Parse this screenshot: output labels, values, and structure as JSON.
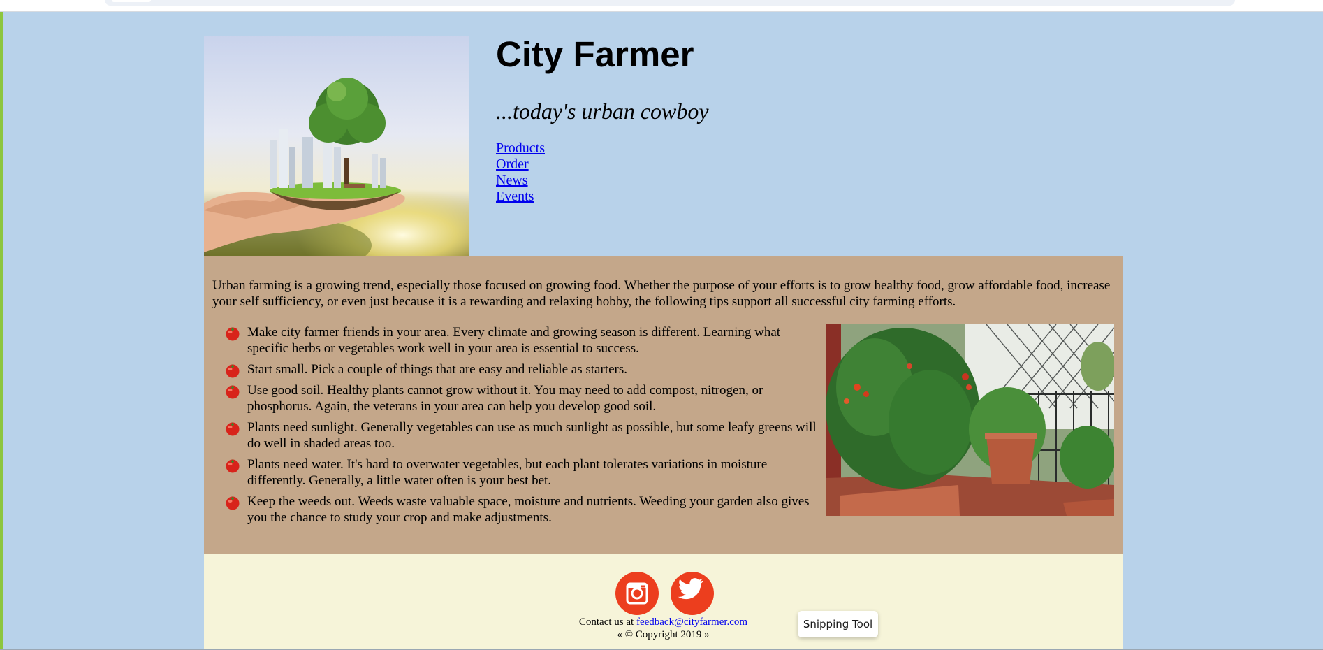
{
  "site": {
    "title": "City Farmer",
    "tagline": "...today's urban cowboy"
  },
  "nav": [
    {
      "label": "Products"
    },
    {
      "label": "Order"
    },
    {
      "label": "News"
    },
    {
      "label": "Events"
    }
  ],
  "intro": "Urban farming is a growing trend, especially those focused on growing food. Whether the purpose of your efforts is to grow healthy food, grow affordable food, increase your self sufficiency, or even just because it is a rewarding and relaxing hobby, the following tips support all successful city farming efforts.",
  "tips": [
    "Make city farmer friends in your area. Every climate and growing season is different. Learning what specific herbs or vegetables work well in your area is essential to success.",
    "Start small. Pick a couple of things that are easy and reliable as starters.",
    "Use good soil. Healthy plants cannot grow without it. You may need to add compost, nitrogen, or phosphorus. Again, the veterans in your area can help you develop good soil.",
    "Plants need sunlight. Generally vegetables can use as much sunlight as possible, but some leafy greens will do well in shaded areas too.",
    "Plants need water. It's hard to overwater vegetables, but each plant tolerates variations in moisture differently. Generally, a little water often is your best bet.",
    "Keep the weeds out. Weeds waste valuable space, moisture and nutrients. Weeding your garden also gives you the chance to study your crop and make adjustments."
  ],
  "footer": {
    "contact_prefix": "Contact us at",
    "email": "feedback@cityfarmer.com",
    "copyright": "« © Copyright 2019 »",
    "social": [
      {
        "icon": "instagram-icon"
      },
      {
        "icon": "twitter-icon"
      }
    ]
  },
  "overlay": {
    "snipping_tool_label": "Snipping Tool"
  },
  "colors": {
    "page_background": "#b8d2ea",
    "content_background": "#c4a78a",
    "footer_background": "#f6f4d9",
    "social_icon": "#ec3e1e",
    "link": "#0000ee",
    "left_accent": "#8dc63f"
  }
}
